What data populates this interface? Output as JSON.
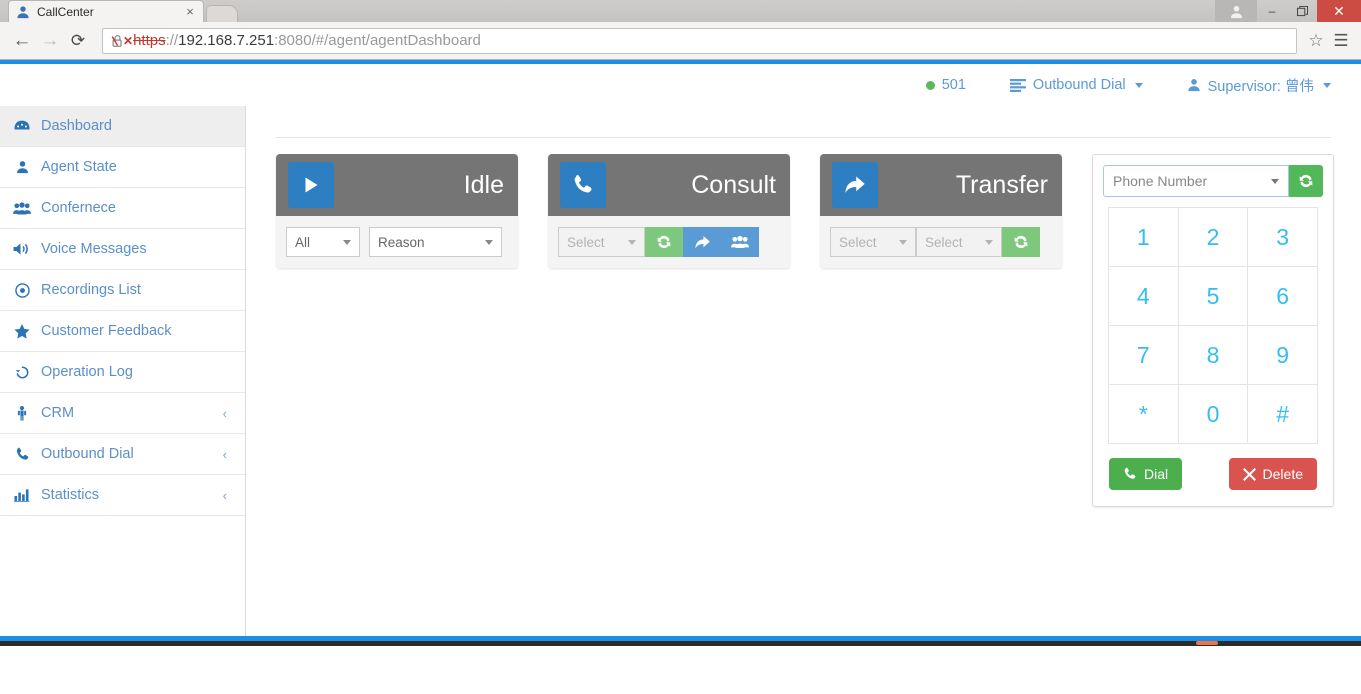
{
  "browser": {
    "tab": {
      "title": "CallCenter",
      "favicon": "user-icon",
      "close_label": "×"
    },
    "new_tab_label": "",
    "window": {
      "profile": "profile-icon",
      "minimize": "–",
      "maximize": "❐",
      "close": "✕"
    },
    "toolbar": {
      "back": "←",
      "forward": "→",
      "reload": "⟳",
      "star": "☆",
      "menu": "☰"
    },
    "url": {
      "scheme": "https",
      "separator": "://",
      "host": "192.168.7.251",
      "rest": ":8080/#/agent/agentDashboard",
      "security": "insecure"
    }
  },
  "topnav": {
    "extension": "501",
    "outbound_dial": "Outbound Dial",
    "supervisor": "Supervisor: 曾伟"
  },
  "sidebar": {
    "items": [
      {
        "label": "Dashboard",
        "icon": "dashboard-icon",
        "active": true,
        "chevron": ""
      },
      {
        "label": "Agent State",
        "icon": "user-icon",
        "active": false,
        "chevron": ""
      },
      {
        "label": "Confernece",
        "icon": "users-icon",
        "active": false,
        "chevron": ""
      },
      {
        "label": "Voice Messages",
        "icon": "volume-icon",
        "active": false,
        "chevron": ""
      },
      {
        "label": "Recordings List",
        "icon": "record-icon",
        "active": false,
        "chevron": ""
      },
      {
        "label": "Customer Feedback",
        "icon": "star-icon",
        "active": false,
        "chevron": ""
      },
      {
        "label": "Operation Log",
        "icon": "history-icon",
        "active": false,
        "chevron": ""
      },
      {
        "label": "CRM",
        "icon": "person-icon",
        "active": false,
        "chevron": "‹"
      },
      {
        "label": "Outbound Dial",
        "icon": "phone-icon",
        "active": false,
        "chevron": "‹"
      },
      {
        "label": "Statistics",
        "icon": "bar-chart-icon",
        "active": false,
        "chevron": "‹"
      }
    ]
  },
  "cards": {
    "idle": {
      "title": "Idle",
      "icon": "play-icon",
      "select_all": "All",
      "select_reason": "Reason"
    },
    "consult": {
      "title": "Consult",
      "icon": "phone-icon",
      "select": "Select",
      "refresh_icon": "refresh-icon",
      "transfer_icon": "share-icon",
      "conference_icon": "users-icon"
    },
    "transfer": {
      "title": "Transfer",
      "icon": "share-icon",
      "select_1": "Select",
      "select_2": "Select",
      "refresh_icon": "refresh-icon"
    }
  },
  "dialpad": {
    "phone_placeholder": "Phone Number",
    "refresh_icon": "refresh-icon",
    "keys": [
      "1",
      "2",
      "3",
      "4",
      "5",
      "6",
      "7",
      "8",
      "9",
      "*",
      "0",
      "#"
    ],
    "dial_label": "Dial",
    "dial_icon": "phone-icon",
    "delete_label": "Delete",
    "delete_icon": "close-icon"
  },
  "colors": {
    "accent_blue": "#1b8fe3",
    "link_blue": "#5b9bd5",
    "card_header_gray": "#757575",
    "key_blue": "#35bdf2",
    "green": "#4cae4c",
    "red": "#d9534f"
  }
}
